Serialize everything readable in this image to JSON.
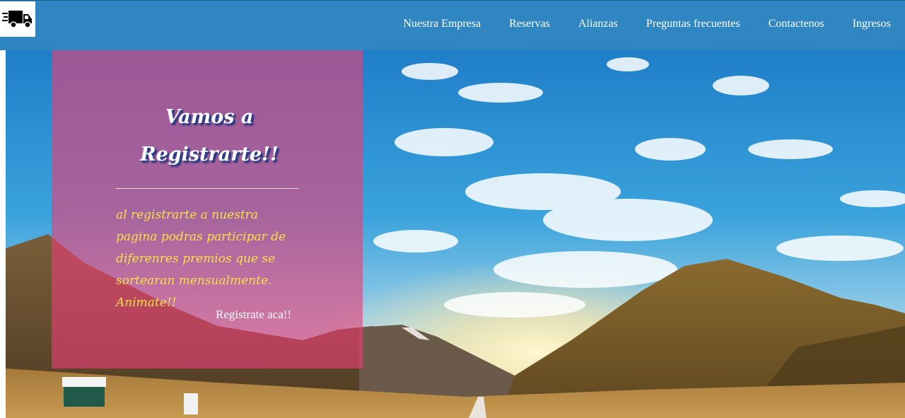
{
  "header": {
    "logo_icon": "delivery-truck-icon",
    "nav": [
      {
        "label": "Nuestra Empresa"
      },
      {
        "label": "Reservas"
      },
      {
        "label": "Alianzas"
      },
      {
        "label": "Preguntas frecuentes"
      },
      {
        "label": "Contactenos"
      },
      {
        "label": "Ingresos"
      }
    ]
  },
  "hero": {
    "background": "mountain-valley-sky-photo"
  },
  "register_panel": {
    "title_line1": "Vamos a",
    "title_line2": "Registrarte!!",
    "body": "al registrarte a nuestra pagina podras participar de diferenres premios que se sortearan mensualmente. Animate!!",
    "link_label": "Registrate aca!!"
  },
  "colors": {
    "topbar": "#2f86c1",
    "panel": "#ea3f78",
    "panel_text": "#f6e14a"
  }
}
